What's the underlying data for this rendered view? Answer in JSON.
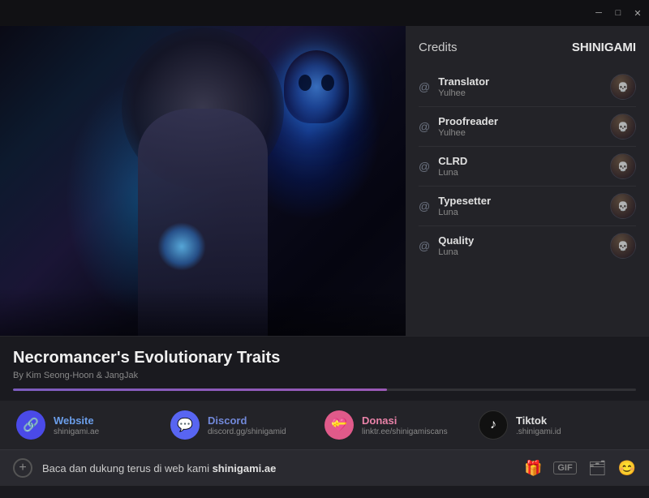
{
  "titlebar": {
    "minimize_label": "─",
    "maximize_label": "□",
    "close_label": "✕"
  },
  "credits": {
    "title": "Credits",
    "brand": "SHINIGAMI",
    "items": [
      {
        "role": "Translator",
        "name": "Yulhee"
      },
      {
        "role": "Proofreader",
        "name": "Yulhee"
      },
      {
        "role": "CLRD",
        "name": "Luna"
      },
      {
        "role": "Typesetter",
        "name": "Luna"
      },
      {
        "role": "Quality",
        "name": "Luna"
      }
    ]
  },
  "manga": {
    "title": "Necromancer's Evolutionary Traits",
    "author": "By Kim Seong-Hoon & JangJak",
    "progress": 60
  },
  "social": [
    {
      "id": "website",
      "label": "Website",
      "url": "shinigami.ae",
      "icon": "🔗"
    },
    {
      "id": "discord",
      "label": "Discord",
      "url": "discord.gg/shinigamid",
      "icon": "💬"
    },
    {
      "id": "donasi",
      "label": "Donasi",
      "url": "linktr.ee/shinigamiscans",
      "icon": "💝"
    },
    {
      "id": "tiktok",
      "label": "Tiktok",
      "url": ".shinigami.id",
      "icon": "♪"
    }
  ],
  "messagebar": {
    "text_prefix": "Baca dan dukung terus di web kami ",
    "text_bold": "shinigami.ae",
    "plus_icon": "+",
    "gift_icon": "🎁",
    "gif_label": "GIF",
    "sticker_icon": "🗂",
    "emoji_icon": "😊"
  }
}
